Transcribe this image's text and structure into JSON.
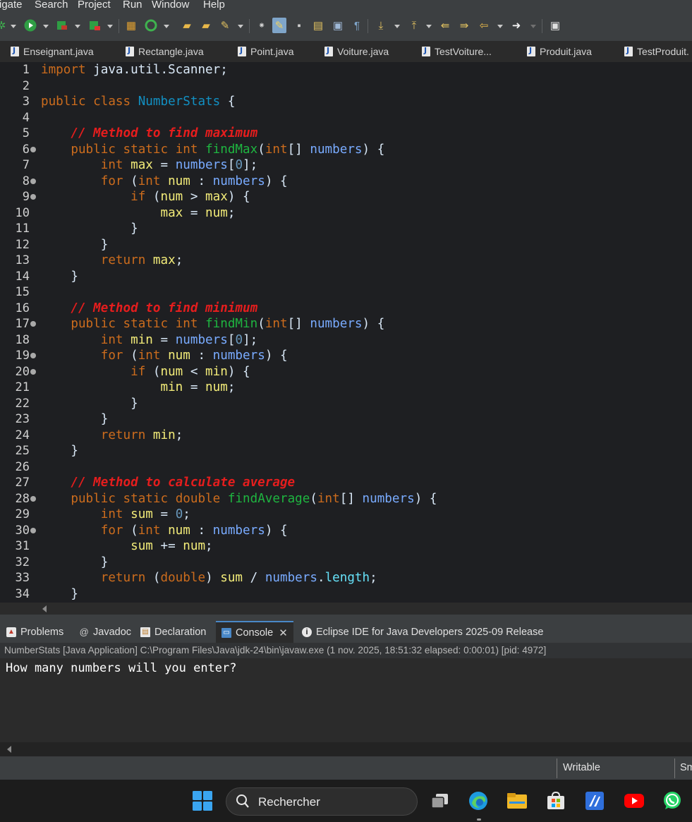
{
  "menu": [
    "igate",
    "Search",
    "Project",
    "Run",
    "Window",
    "Help"
  ],
  "toolbar_icons": [
    "debug-icon",
    "run-icon",
    "run-coverage-icon",
    "external-tools-icon",
    "new-java-package-icon",
    "new-java-class-icon",
    "open-type-icon",
    "open-task-icon",
    "search-icon",
    "toggle-breadcrumb-icon",
    "toggle-mark-occurrences-icon",
    "toggle-block-selection-icon",
    "word-wrap-icon",
    "show-whitespace-icon",
    "next-annotation-icon",
    "previous-annotation-icon",
    "last-edit-location-icon",
    "back-icon",
    "forward-icon",
    "open-perspective-icon"
  ],
  "editor_tabs": [
    "Enseignant.java",
    "Rectangle.java",
    "Point.java",
    "Voiture.java",
    "TestVoiture...",
    "Produit.java",
    "TestProduit."
  ],
  "code_lines": [
    {
      "n": "1",
      "fold": false,
      "tokens": [
        [
          "kw",
          "import"
        ],
        [
          "p",
          " java.util.Scanner;"
        ]
      ]
    },
    {
      "n": "2",
      "fold": false,
      "tokens": []
    },
    {
      "n": "3",
      "fold": false,
      "tokens": [
        [
          "kw",
          "public"
        ],
        [
          "p",
          " "
        ],
        [
          "kw",
          "class"
        ],
        [
          "p",
          " "
        ],
        [
          "cls",
          "NumberStats"
        ],
        [
          "p",
          " {"
        ]
      ]
    },
    {
      "n": "4",
      "fold": false,
      "tokens": []
    },
    {
      "n": "5",
      "fold": false,
      "tokens": [
        [
          "p",
          "    "
        ],
        [
          "cmt",
          "// Method to find maximum"
        ]
      ]
    },
    {
      "n": "6",
      "fold": true,
      "tokens": [
        [
          "p",
          "    "
        ],
        [
          "kw",
          "public"
        ],
        [
          "p",
          " "
        ],
        [
          "kw",
          "static"
        ],
        [
          "p",
          " "
        ],
        [
          "ty",
          "int"
        ],
        [
          "p",
          " "
        ],
        [
          "mth",
          "findMax"
        ],
        [
          "p",
          "("
        ],
        [
          "ty",
          "int"
        ],
        [
          "p",
          "[] "
        ],
        [
          "prm",
          "numbers"
        ],
        [
          "p",
          ") {"
        ]
      ]
    },
    {
      "n": "7",
      "fold": false,
      "tokens": [
        [
          "p",
          "        "
        ],
        [
          "ty",
          "int"
        ],
        [
          "p",
          " "
        ],
        [
          "var",
          "max"
        ],
        [
          "p",
          " = "
        ],
        [
          "prm",
          "numbers"
        ],
        [
          "p",
          "["
        ],
        [
          "num",
          "0"
        ],
        [
          "p",
          "];"
        ]
      ]
    },
    {
      "n": "8",
      "fold": true,
      "tokens": [
        [
          "p",
          "        "
        ],
        [
          "kw",
          "for"
        ],
        [
          "p",
          " ("
        ],
        [
          "ty",
          "int"
        ],
        [
          "p",
          " "
        ],
        [
          "var",
          "num"
        ],
        [
          "p",
          " : "
        ],
        [
          "prm",
          "numbers"
        ],
        [
          "p",
          ") {"
        ]
      ]
    },
    {
      "n": "9",
      "fold": true,
      "tokens": [
        [
          "p",
          "            "
        ],
        [
          "kw",
          "if"
        ],
        [
          "p",
          " ("
        ],
        [
          "var",
          "num"
        ],
        [
          "p",
          " > "
        ],
        [
          "var",
          "max"
        ],
        [
          "p",
          ") {"
        ]
      ]
    },
    {
      "n": "10",
      "fold": false,
      "tokens": [
        [
          "p",
          "                "
        ],
        [
          "var",
          "max"
        ],
        [
          "p",
          " = "
        ],
        [
          "var",
          "num"
        ],
        [
          "p",
          ";"
        ]
      ]
    },
    {
      "n": "11",
      "fold": false,
      "tokens": [
        [
          "p",
          "            }"
        ]
      ]
    },
    {
      "n": "12",
      "fold": false,
      "tokens": [
        [
          "p",
          "        }"
        ]
      ]
    },
    {
      "n": "13",
      "fold": false,
      "tokens": [
        [
          "p",
          "        "
        ],
        [
          "kw",
          "return"
        ],
        [
          "p",
          " "
        ],
        [
          "var",
          "max"
        ],
        [
          "p",
          ";"
        ]
      ]
    },
    {
      "n": "14",
      "fold": false,
      "tokens": [
        [
          "p",
          "    }"
        ]
      ]
    },
    {
      "n": "15",
      "fold": false,
      "tokens": []
    },
    {
      "n": "16",
      "fold": false,
      "tokens": [
        [
          "p",
          "    "
        ],
        [
          "cmt",
          "// Method to find minimum"
        ]
      ]
    },
    {
      "n": "17",
      "fold": true,
      "tokens": [
        [
          "p",
          "    "
        ],
        [
          "kw",
          "public"
        ],
        [
          "p",
          " "
        ],
        [
          "kw",
          "static"
        ],
        [
          "p",
          " "
        ],
        [
          "ty",
          "int"
        ],
        [
          "p",
          " "
        ],
        [
          "mth",
          "findMin"
        ],
        [
          "p",
          "("
        ],
        [
          "ty",
          "int"
        ],
        [
          "p",
          "[] "
        ],
        [
          "prm",
          "numbers"
        ],
        [
          "p",
          ") {"
        ]
      ]
    },
    {
      "n": "18",
      "fold": false,
      "tokens": [
        [
          "p",
          "        "
        ],
        [
          "ty",
          "int"
        ],
        [
          "p",
          " "
        ],
        [
          "var",
          "min"
        ],
        [
          "p",
          " = "
        ],
        [
          "prm",
          "numbers"
        ],
        [
          "p",
          "["
        ],
        [
          "num",
          "0"
        ],
        [
          "p",
          "];"
        ]
      ]
    },
    {
      "n": "19",
      "fold": true,
      "tokens": [
        [
          "p",
          "        "
        ],
        [
          "kw",
          "for"
        ],
        [
          "p",
          " ("
        ],
        [
          "ty",
          "int"
        ],
        [
          "p",
          " "
        ],
        [
          "var",
          "num"
        ],
        [
          "p",
          " : "
        ],
        [
          "prm",
          "numbers"
        ],
        [
          "p",
          ") {"
        ]
      ]
    },
    {
      "n": "20",
      "fold": true,
      "tokens": [
        [
          "p",
          "            "
        ],
        [
          "kw",
          "if"
        ],
        [
          "p",
          " ("
        ],
        [
          "var",
          "num"
        ],
        [
          "p",
          " < "
        ],
        [
          "var",
          "min"
        ],
        [
          "p",
          ") {"
        ]
      ]
    },
    {
      "n": "21",
      "fold": false,
      "tokens": [
        [
          "p",
          "                "
        ],
        [
          "var",
          "min"
        ],
        [
          "p",
          " = "
        ],
        [
          "var",
          "num"
        ],
        [
          "p",
          ";"
        ]
      ]
    },
    {
      "n": "22",
      "fold": false,
      "tokens": [
        [
          "p",
          "            }"
        ]
      ]
    },
    {
      "n": "23",
      "fold": false,
      "tokens": [
        [
          "p",
          "        }"
        ]
      ]
    },
    {
      "n": "24",
      "fold": false,
      "tokens": [
        [
          "p",
          "        "
        ],
        [
          "kw",
          "return"
        ],
        [
          "p",
          " "
        ],
        [
          "var",
          "min"
        ],
        [
          "p",
          ";"
        ]
      ]
    },
    {
      "n": "25",
      "fold": false,
      "tokens": [
        [
          "p",
          "    }"
        ]
      ]
    },
    {
      "n": "26",
      "fold": false,
      "tokens": []
    },
    {
      "n": "27",
      "fold": false,
      "tokens": [
        [
          "p",
          "    "
        ],
        [
          "cmt",
          "// Method to calculate average"
        ]
      ]
    },
    {
      "n": "28",
      "fold": true,
      "tokens": [
        [
          "p",
          "    "
        ],
        [
          "kw",
          "public"
        ],
        [
          "p",
          " "
        ],
        [
          "kw",
          "static"
        ],
        [
          "p",
          " "
        ],
        [
          "ty",
          "double"
        ],
        [
          "p",
          " "
        ],
        [
          "mth",
          "findAverage"
        ],
        [
          "p",
          "("
        ],
        [
          "ty",
          "int"
        ],
        [
          "p",
          "[] "
        ],
        [
          "prm",
          "numbers"
        ],
        [
          "p",
          ") {"
        ]
      ]
    },
    {
      "n": "29",
      "fold": false,
      "tokens": [
        [
          "p",
          "        "
        ],
        [
          "ty",
          "int"
        ],
        [
          "p",
          " "
        ],
        [
          "var",
          "sum"
        ],
        [
          "p",
          " = "
        ],
        [
          "num",
          "0"
        ],
        [
          "p",
          ";"
        ]
      ]
    },
    {
      "n": "30",
      "fold": true,
      "tokens": [
        [
          "p",
          "        "
        ],
        [
          "kw",
          "for"
        ],
        [
          "p",
          " ("
        ],
        [
          "ty",
          "int"
        ],
        [
          "p",
          " "
        ],
        [
          "var",
          "num"
        ],
        [
          "p",
          " : "
        ],
        [
          "prm",
          "numbers"
        ],
        [
          "p",
          ") {"
        ]
      ]
    },
    {
      "n": "31",
      "fold": false,
      "tokens": [
        [
          "p",
          "            "
        ],
        [
          "var",
          "sum"
        ],
        [
          "p",
          " += "
        ],
        [
          "var",
          "num"
        ],
        [
          "p",
          ";"
        ]
      ]
    },
    {
      "n": "32",
      "fold": false,
      "tokens": [
        [
          "p",
          "        }"
        ]
      ]
    },
    {
      "n": "33",
      "fold": false,
      "tokens": [
        [
          "p",
          "        "
        ],
        [
          "kw",
          "return"
        ],
        [
          "p",
          " ("
        ],
        [
          "ty",
          "double"
        ],
        [
          "p",
          ") "
        ],
        [
          "var",
          "sum"
        ],
        [
          "p",
          " / "
        ],
        [
          "prm",
          "numbers"
        ],
        [
          "p",
          "."
        ],
        [
          "fld",
          "length"
        ],
        [
          "p",
          ";"
        ]
      ]
    },
    {
      "n": "34",
      "fold": false,
      "tokens": [
        [
          "p",
          "    }"
        ]
      ]
    }
  ],
  "views": {
    "problems": "Problems",
    "javadoc": "Javadoc",
    "declaration": "Declaration",
    "console": "Console",
    "eclipse_info": "Eclipse IDE for Java Developers 2025-09 Release"
  },
  "console": {
    "process_line": "NumberStats [Java Application] C:\\Program Files\\Java\\jdk-24\\bin\\javaw.exe  (1 nov. 2025, 18:51:32 elapsed: 0:00:01) [pid: 4972]",
    "output": "How many numbers will you enter?"
  },
  "status": {
    "writable": "Writable",
    "insert_mode": "Sm"
  },
  "taskbar": {
    "search_label": "Rechercher",
    "apps": [
      "start-icon",
      "task-view-icon",
      "edge-icon",
      "file-explorer-icon",
      "microsoft-store-icon",
      "eclipse-launcher-icon",
      "youtube-icon",
      "whatsapp-icon"
    ]
  },
  "colors": {
    "keyword": "#cc6c1d",
    "comment": "#e51d1d",
    "method": "#1eb540",
    "class_name": "#1290c3",
    "parameter": "#79abff",
    "local_variable": "#f3ec79",
    "field": "#66e1f8",
    "number": "#6897bb"
  }
}
